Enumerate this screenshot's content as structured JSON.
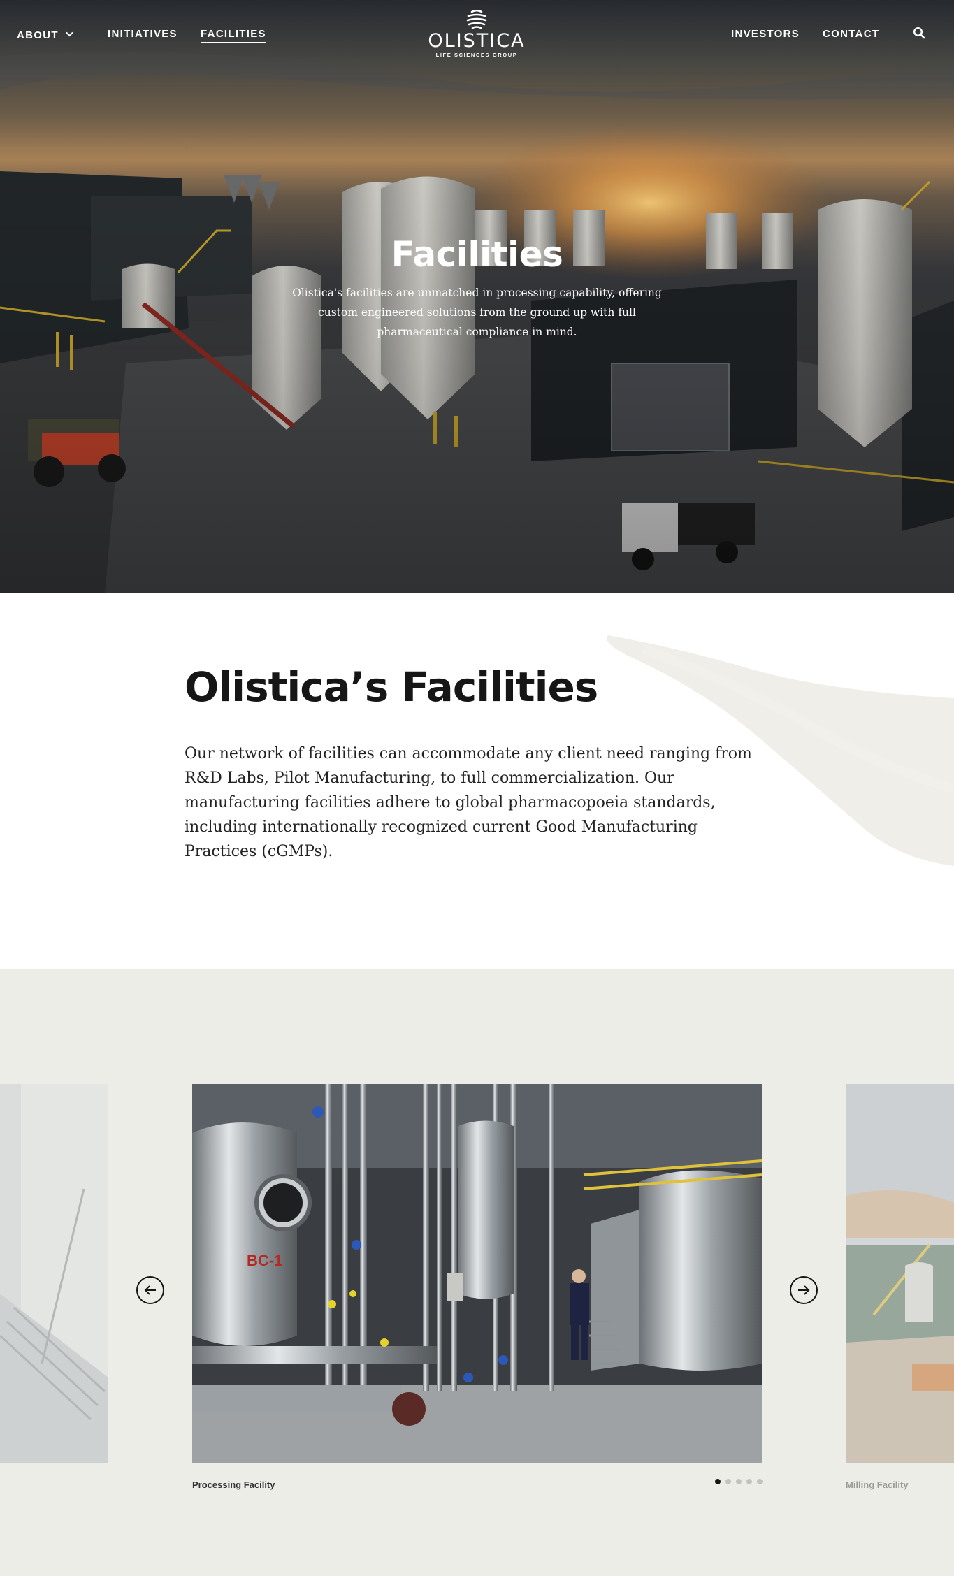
{
  "nav": {
    "about": "ABOUT",
    "initiatives": "INITIATIVES",
    "facilities": "FACILITIES",
    "investors": "INVESTORS",
    "contact": "CONTACT",
    "icons": {
      "about_dropdown": "chevron-down-icon",
      "search": "search-icon"
    }
  },
  "logo": {
    "name": "OLISTICA",
    "tagline": "LIFE SCIENCES GROUP"
  },
  "hero": {
    "title": "Facilities",
    "description": "Olistica's facilities are unmatched in processing capability, offering custom engineered solutions from the ground up with full pharmaceutical compliance in mind."
  },
  "intro": {
    "title": "Olistica’s Facilities",
    "body": "Our network of facilities can accommodate any client need ranging from R&D Labs, Pilot Manufacturing, to full commercialization. Our manufacturing facilities adhere to global pharmacopoeia standards, including internationally recognized current Good Manufacturing Practices (cGMPs)."
  },
  "carousel": {
    "current_caption": "Processing Facility",
    "next_caption": "Milling Facility",
    "active_slide": 1,
    "slide_count": 5,
    "icons": {
      "prev": "arrow-left-icon",
      "next": "arrow-right-icon"
    }
  },
  "colors": {
    "text": "#161616",
    "carousel_bg": "#edede8",
    "nav_text": "#ffffff",
    "dot_active": "#161616",
    "dot_inactive": "#c3c3be"
  }
}
